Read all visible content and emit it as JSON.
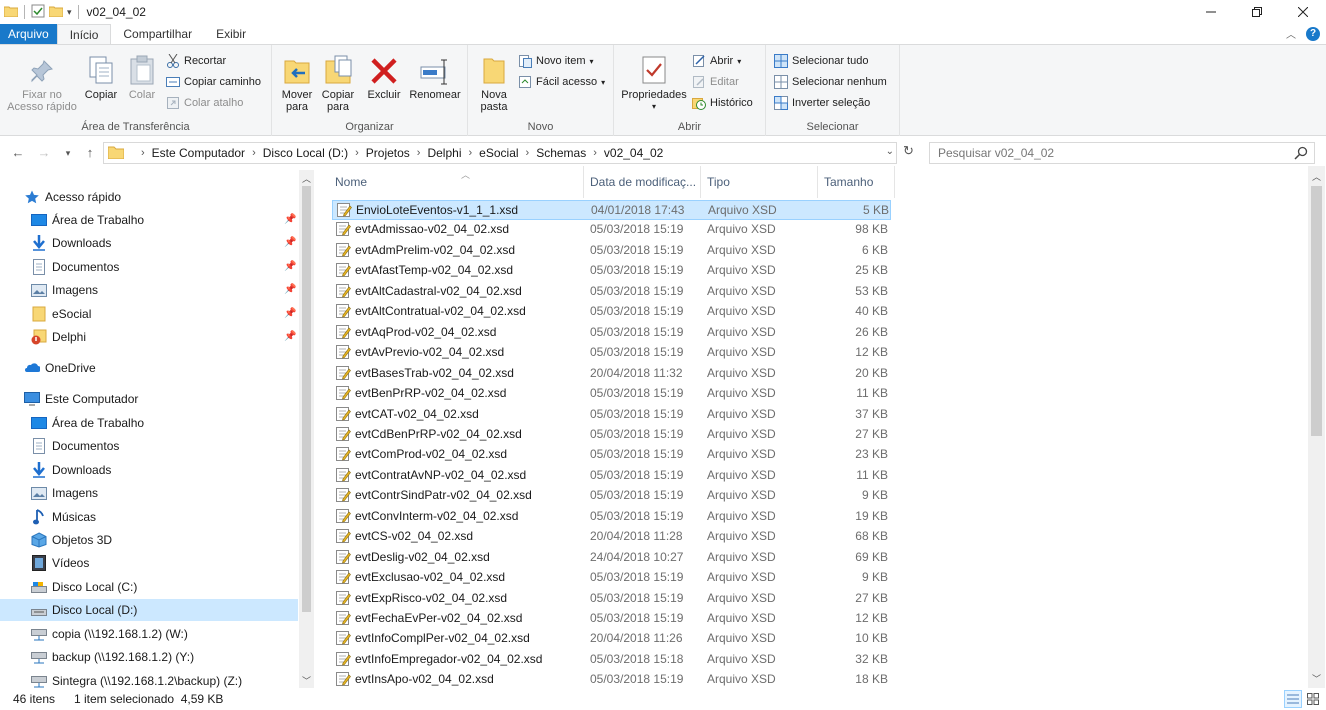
{
  "window": {
    "title": "v02_04_02"
  },
  "ribbon_tabs": {
    "file": "Arquivo",
    "home": "Início",
    "share": "Compartilhar",
    "view": "Exibir"
  },
  "ribbon": {
    "clipboard": {
      "label": "Área de Transferência",
      "pin": "Fixar no Acesso rápido",
      "copy": "Copiar",
      "paste": "Colar",
      "cut": "Recortar",
      "copy_path": "Copiar caminho",
      "paste_shortcut": "Colar atalho"
    },
    "organize": {
      "label": "Organizar",
      "move_to": "Mover para",
      "copy_to": "Copiar para",
      "delete": "Excluir",
      "rename": "Renomear"
    },
    "new": {
      "label": "Novo",
      "new_folder": "Nova pasta",
      "new_item": "Novo item",
      "easy_access": "Fácil acesso"
    },
    "open": {
      "label": "Abrir",
      "properties": "Propriedades",
      "open": "Abrir",
      "edit": "Editar",
      "history": "Histórico"
    },
    "select": {
      "label": "Selecionar",
      "select_all": "Selecionar tudo",
      "select_none": "Selecionar nenhum",
      "invert": "Inverter seleção"
    }
  },
  "address": {
    "crumbs": [
      "Este Computador",
      "Disco Local (D:)",
      "Projetos",
      "Delphi",
      "eSocial",
      "Schemas",
      "v02_04_02"
    ],
    "search_placeholder": "Pesquisar v02_04_02"
  },
  "nav": {
    "quick_access": "Acesso rápido",
    "quick_items": [
      "Área de Trabalho",
      "Downloads",
      "Documentos",
      "Imagens",
      "eSocial",
      "Delphi"
    ],
    "onedrive": "OneDrive",
    "this_pc": "Este Computador",
    "pc_items": [
      "Área de Trabalho",
      "Documentos",
      "Downloads",
      "Imagens",
      "Músicas",
      "Objetos 3D",
      "Vídeos",
      "Disco Local (C:)",
      "Disco Local (D:)",
      "copia (\\\\192.168.1.2) (W:)",
      "backup (\\\\192.168.1.2) (Y:)",
      "Sintegra (\\\\192.168.1.2\\backup) (Z:)"
    ]
  },
  "columns": {
    "name": "Nome",
    "date": "Data de modificaç...",
    "type": "Tipo",
    "size": "Tamanho"
  },
  "files": [
    {
      "name": "EnvioLoteEventos-v1_1_1.xsd",
      "date": "04/01/2018 17:43",
      "type": "Arquivo XSD",
      "size": "5 KB"
    },
    {
      "name": "evtAdmissao-v02_04_02.xsd",
      "date": "05/03/2018 15:19",
      "type": "Arquivo XSD",
      "size": "98 KB"
    },
    {
      "name": "evtAdmPrelim-v02_04_02.xsd",
      "date": "05/03/2018 15:19",
      "type": "Arquivo XSD",
      "size": "6 KB"
    },
    {
      "name": "evtAfastTemp-v02_04_02.xsd",
      "date": "05/03/2018 15:19",
      "type": "Arquivo XSD",
      "size": "25 KB"
    },
    {
      "name": "evtAltCadastral-v02_04_02.xsd",
      "date": "05/03/2018 15:19",
      "type": "Arquivo XSD",
      "size": "53 KB"
    },
    {
      "name": "evtAltContratual-v02_04_02.xsd",
      "date": "05/03/2018 15:19",
      "type": "Arquivo XSD",
      "size": "40 KB"
    },
    {
      "name": "evtAqProd-v02_04_02.xsd",
      "date": "05/03/2018 15:19",
      "type": "Arquivo XSD",
      "size": "26 KB"
    },
    {
      "name": "evtAvPrevio-v02_04_02.xsd",
      "date": "05/03/2018 15:19",
      "type": "Arquivo XSD",
      "size": "12 KB"
    },
    {
      "name": "evtBasesTrab-v02_04_02.xsd",
      "date": "20/04/2018 11:32",
      "type": "Arquivo XSD",
      "size": "20 KB"
    },
    {
      "name": "evtBenPrRP-v02_04_02.xsd",
      "date": "05/03/2018 15:19",
      "type": "Arquivo XSD",
      "size": "11 KB"
    },
    {
      "name": "evtCAT-v02_04_02.xsd",
      "date": "05/03/2018 15:19",
      "type": "Arquivo XSD",
      "size": "37 KB"
    },
    {
      "name": "evtCdBenPrRP-v02_04_02.xsd",
      "date": "05/03/2018 15:19",
      "type": "Arquivo XSD",
      "size": "27 KB"
    },
    {
      "name": "evtComProd-v02_04_02.xsd",
      "date": "05/03/2018 15:19",
      "type": "Arquivo XSD",
      "size": "23 KB"
    },
    {
      "name": "evtContratAvNP-v02_04_02.xsd",
      "date": "05/03/2018 15:19",
      "type": "Arquivo XSD",
      "size": "11 KB"
    },
    {
      "name": "evtContrSindPatr-v02_04_02.xsd",
      "date": "05/03/2018 15:19",
      "type": "Arquivo XSD",
      "size": "9 KB"
    },
    {
      "name": "evtConvInterm-v02_04_02.xsd",
      "date": "05/03/2018 15:19",
      "type": "Arquivo XSD",
      "size": "19 KB"
    },
    {
      "name": "evtCS-v02_04_02.xsd",
      "date": "20/04/2018 11:28",
      "type": "Arquivo XSD",
      "size": "68 KB"
    },
    {
      "name": "evtDeslig-v02_04_02.xsd",
      "date": "24/04/2018 10:27",
      "type": "Arquivo XSD",
      "size": "69 KB"
    },
    {
      "name": "evtExclusao-v02_04_02.xsd",
      "date": "05/03/2018 15:19",
      "type": "Arquivo XSD",
      "size": "9 KB"
    },
    {
      "name": "evtExpRisco-v02_04_02.xsd",
      "date": "05/03/2018 15:19",
      "type": "Arquivo XSD",
      "size": "27 KB"
    },
    {
      "name": "evtFechaEvPer-v02_04_02.xsd",
      "date": "05/03/2018 15:19",
      "type": "Arquivo XSD",
      "size": "12 KB"
    },
    {
      "name": "evtInfoComplPer-v02_04_02.xsd",
      "date": "20/04/2018 11:26",
      "type": "Arquivo XSD",
      "size": "10 KB"
    },
    {
      "name": "evtInfoEmpregador-v02_04_02.xsd",
      "date": "05/03/2018 15:18",
      "type": "Arquivo XSD",
      "size": "32 KB"
    },
    {
      "name": "evtInsApo-v02_04_02.xsd",
      "date": "05/03/2018 15:19",
      "type": "Arquivo XSD",
      "size": "18 KB"
    }
  ],
  "status": {
    "count": "46 itens",
    "selection": "1 item selecionado  4,59 KB"
  },
  "colors": {
    "accent": "#1979ca",
    "selection": "#cce8ff",
    "selection_border": "#99d1ff"
  }
}
